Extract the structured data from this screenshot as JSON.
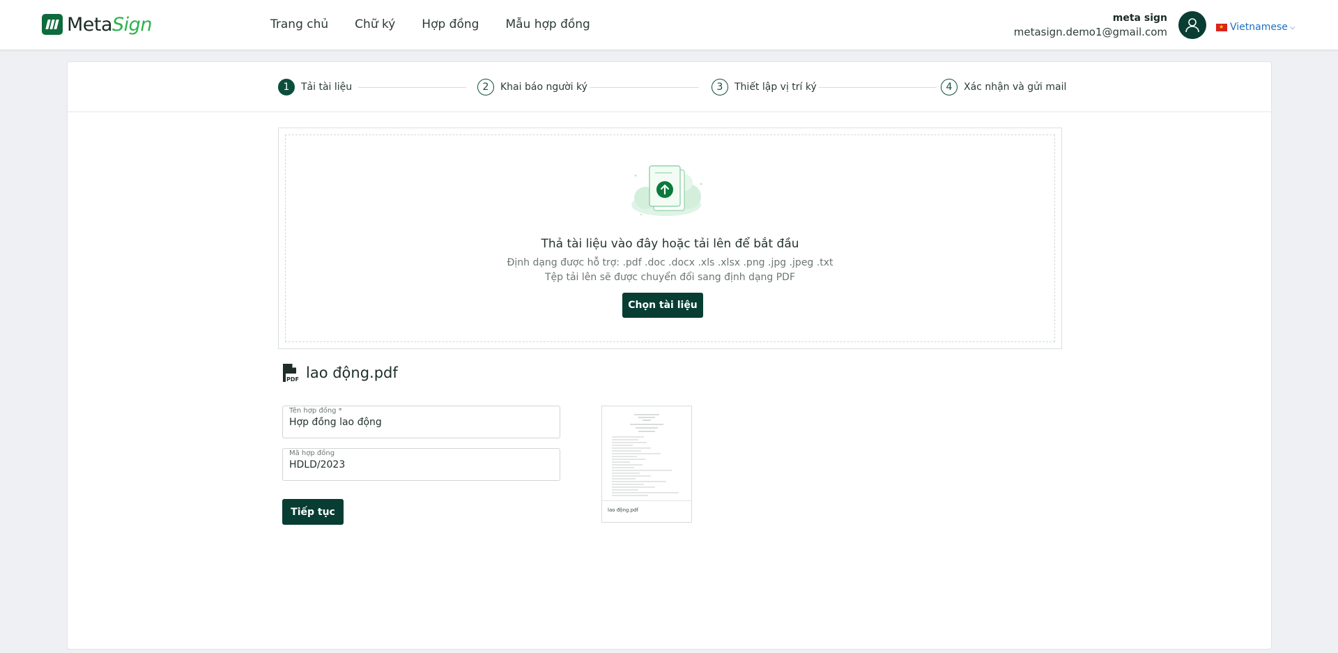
{
  "header": {
    "logo": {
      "part1": "Meta",
      "part2": "Sign"
    },
    "nav": [
      "Trang chủ",
      "Chữ ký",
      "Hợp đồng",
      "Mẫu hợp đồng"
    ],
    "user": {
      "name": "meta sign",
      "email": "metasign.demo1@gmail.com"
    },
    "language": "Vietnamese"
  },
  "steps": [
    {
      "num": "1",
      "label": "Tải tài liệu",
      "active": true
    },
    {
      "num": "2",
      "label": "Khai báo người ký",
      "active": false
    },
    {
      "num": "3",
      "label": "Thiết lập vị trí ký",
      "active": false
    },
    {
      "num": "4",
      "label": "Xác nhận và gửi mail",
      "active": false
    }
  ],
  "upload": {
    "title": "Thả tài liệu vào đây hoặc tải lên để bắt đầu",
    "formats": "Định dạng được hỗ trợ: .pdf .doc .docx .xls .xlsx .png .jpg .jpeg .txt",
    "convert_note": "Tệp tải lên sẽ được chuyển đổi sang định dạng PDF",
    "choose_label": "Chọn tài liệu"
  },
  "file": {
    "name": "lao động.pdf",
    "pdf_badge": "PDF",
    "thumb_caption": "lao động.pdf"
  },
  "form": {
    "contract_name_label": "Tên hợp đồng *",
    "contract_name_value": "Hợp đồng lao động",
    "contract_code_label": "Mã hợp đồng",
    "contract_code_value": "HDLD/2023",
    "continue_label": "Tiếp tục"
  },
  "colors": {
    "primary": "#073d33",
    "brand_green": "#2bb24c",
    "link": "#1c6fbf"
  }
}
